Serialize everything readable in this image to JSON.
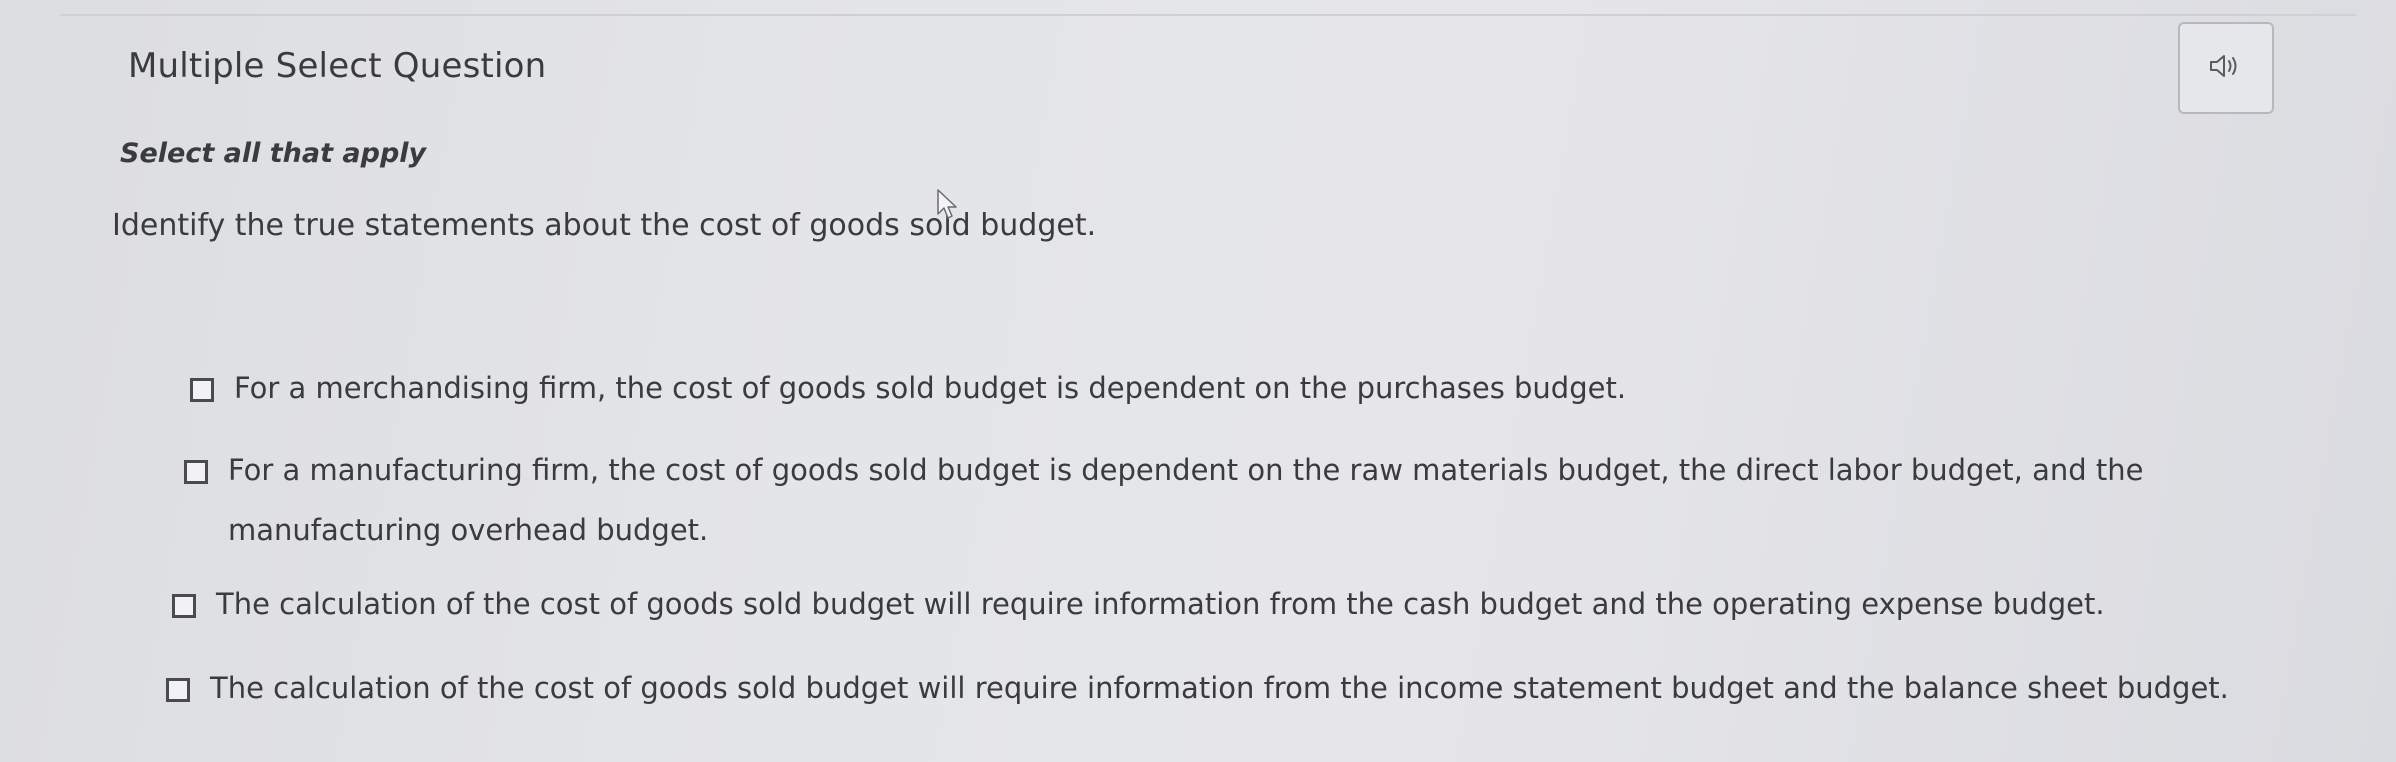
{
  "question": {
    "type_label": "Multiple Select Question",
    "instruction": "Select all that apply",
    "prompt": "Identify the true statements about the cost of goods sold budget.",
    "audio_icon": "speaker-icon"
  },
  "options": [
    {
      "label": "For a merchandising firm, the cost of goods sold budget is dependent on the purchases budget.",
      "checked": false
    },
    {
      "label": "For a manufacturing firm, the cost of goods sold budget is dependent on the raw materials budget, the direct labor budget, and the manufacturing overhead budget.",
      "checked": false
    },
    {
      "label": "The calculation of the cost of goods sold budget will require information from the cash budget and the operating expense budget.",
      "checked": false
    },
    {
      "label": "The calculation of the cost of goods sold budget will require information from the income statement budget and the balance sheet budget.",
      "checked": false
    }
  ],
  "colors": {
    "text": "#3a3b3e",
    "checkbox_border": "#4a4b4f",
    "background": "#e4e5e8"
  }
}
